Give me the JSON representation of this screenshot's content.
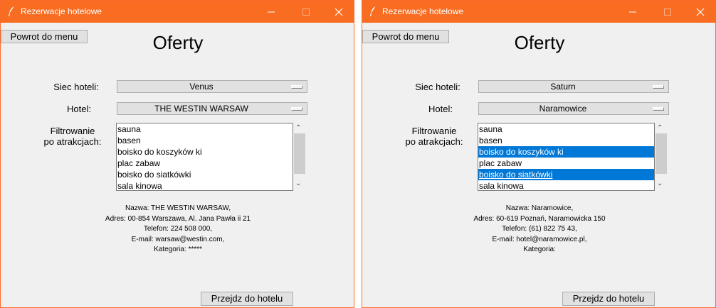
{
  "windows": [
    {
      "title": "Rezerwacje hotelowe",
      "back_label": "Powrot do menu",
      "heading": "Oferty",
      "chain_label": "Siec hoteli:",
      "chain_value": "Venus",
      "hotel_label": "Hotel:",
      "hotel_value": "THE WESTIN WARSAW",
      "filter_label_1": "Filtrowanie",
      "filter_label_2": "po atrakcjach:",
      "attractions": [
        {
          "label": "sauna",
          "selected": false
        },
        {
          "label": "basen",
          "selected": false
        },
        {
          "label": "boisko do koszyków ki",
          "selected": false
        },
        {
          "label": "plac zabaw",
          "selected": false
        },
        {
          "label": "boisko do siatkówki",
          "selected": false
        },
        {
          "label": "sala kinowa",
          "selected": false
        }
      ],
      "info": [
        "Nazwa: THE WESTIN WARSAW,",
        "Adres: 00-854 Warszawa, Al. Jana Pawła ii 21",
        "Telefon: 224 508 000,",
        "E-mail: warsaw@westin.com,",
        "Kategoria: *****"
      ],
      "go_label": "Przejdz do hotelu"
    },
    {
      "title": "Rezerwacje hotelowe",
      "back_label": "Powrot do menu",
      "heading": "Oferty",
      "chain_label": "Siec hoteli:",
      "chain_value": "Saturn",
      "hotel_label": "Hotel:",
      "hotel_value": "Naramowice",
      "filter_label_1": "Filtrowanie",
      "filter_label_2": "po atrakcjach:",
      "attractions": [
        {
          "label": "sauna",
          "selected": false
        },
        {
          "label": "basen",
          "selected": false
        },
        {
          "label": "boisko do koszyków ki",
          "selected": true
        },
        {
          "label": "plac zabaw",
          "selected": false
        },
        {
          "label": "boisko do siatkówki",
          "selected": true,
          "active": true
        },
        {
          "label": "sala kinowa",
          "selected": false
        }
      ],
      "info": [
        "Nazwa: Naramowice,",
        "Adres: 60-619 Poznań, Naramowicka 150",
        "Telefon: (61) 822 75 43,",
        "E-mail: hotel@naramowice.pl,",
        "Kategoria:"
      ],
      "go_label": "Przejdz do hotelu"
    }
  ],
  "colors": {
    "titlebar": "#f86d22",
    "window_bg": "#f0f0f0",
    "selection": "#0078d7"
  },
  "icons": {
    "app": "feather-icon",
    "minimize": "minimize-icon",
    "maximize": "maximize-icon",
    "close": "close-icon",
    "scroll_up": "scroll-up-icon",
    "scroll_down": "scroll-down-icon",
    "dropdown": "dropdown-indicator-icon"
  }
}
